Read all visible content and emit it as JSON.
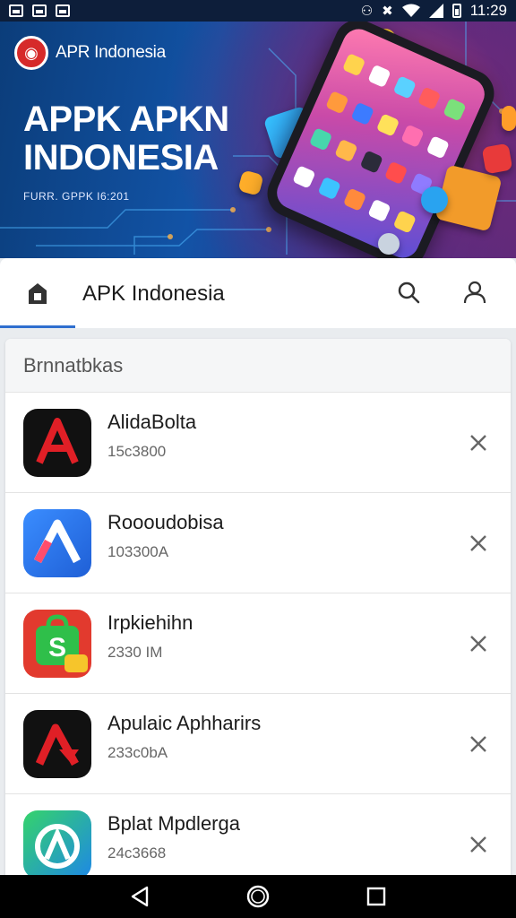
{
  "status_bar": {
    "time": "11:29",
    "icons": [
      "image-icon",
      "photo-icon",
      "news-icon",
      "vibrate-icon",
      "mute-icon",
      "wifi-icon",
      "signal-icon",
      "battery-icon"
    ]
  },
  "banner": {
    "brand_name": "APR Indonesia",
    "title": "APPK APKN INDONESIA",
    "subtitle": "FURR. GPPK I6:201"
  },
  "app_bar": {
    "title": "APK Indonesia",
    "icons": [
      "home-icon",
      "search-icon",
      "person-icon"
    ],
    "accent": "#2f6fcf"
  },
  "list": {
    "header": "Brnnatbkas",
    "items": [
      {
        "name": "AlidaBolta",
        "size": "15c3800",
        "icon": "red-a-icon"
      },
      {
        "name": "Roooudobisa",
        "size": "103300A",
        "icon": "blue-a-icon"
      },
      {
        "name": "Irpkiehihn",
        "size": "2330 IM",
        "icon": "green-s-bag-icon"
      },
      {
        "name": "Apulaic Aphharirs",
        "size": "233c0bA",
        "icon": "red-lambda-icon"
      },
      {
        "name": "Bplat Mpdlerga",
        "size": "24c3668",
        "icon": "green-blue-a-icon"
      }
    ]
  },
  "nav_bar": {
    "icons": [
      "back-icon",
      "home-circle-icon",
      "recents-icon"
    ]
  }
}
